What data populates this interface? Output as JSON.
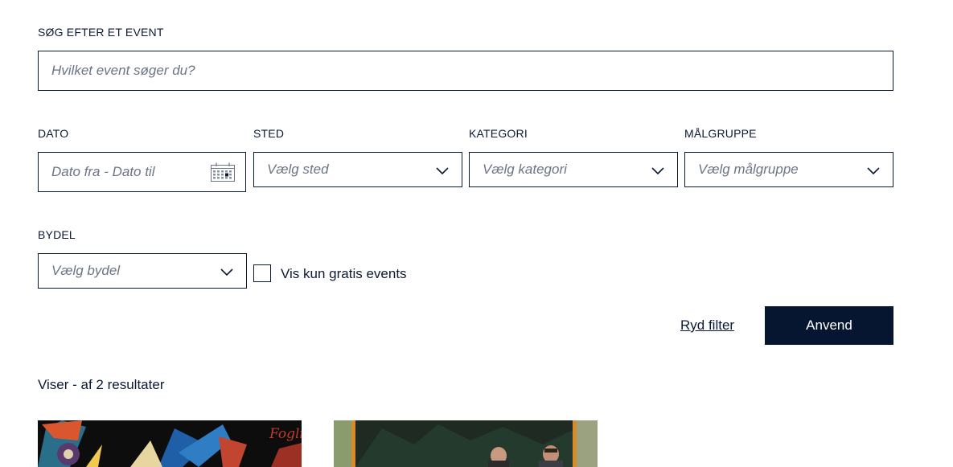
{
  "search": {
    "label": "SØG EFTER ET EVENT",
    "placeholder": "Hvilket event søger du?"
  },
  "filters": {
    "date": {
      "label": "DATO",
      "placeholder": "Dato fra - Dato til",
      "icon": "calendar-icon"
    },
    "place": {
      "label": "STED",
      "placeholder": "Vælg sted",
      "icon": "chevron-down-icon"
    },
    "category": {
      "label": "KATEGORI",
      "placeholder": "Vælg kategori",
      "icon": "chevron-down-icon"
    },
    "audience": {
      "label": "MÅLGRUPPE",
      "placeholder": "Vælg målgruppe",
      "icon": "chevron-down-icon"
    },
    "district": {
      "label": "BYDEL",
      "placeholder": "Vælg bydel",
      "icon": "chevron-down-icon"
    },
    "free_only": {
      "label": "Vis kun gratis events",
      "checked": false
    }
  },
  "actions": {
    "clear_label": "Ryd filter",
    "apply_label": "Anvend"
  },
  "results": {
    "summary": "Viser - af 2 resultater"
  },
  "colors": {
    "primary": "#071630",
    "text": "#0b1a33",
    "placeholder": "#6b7585"
  }
}
